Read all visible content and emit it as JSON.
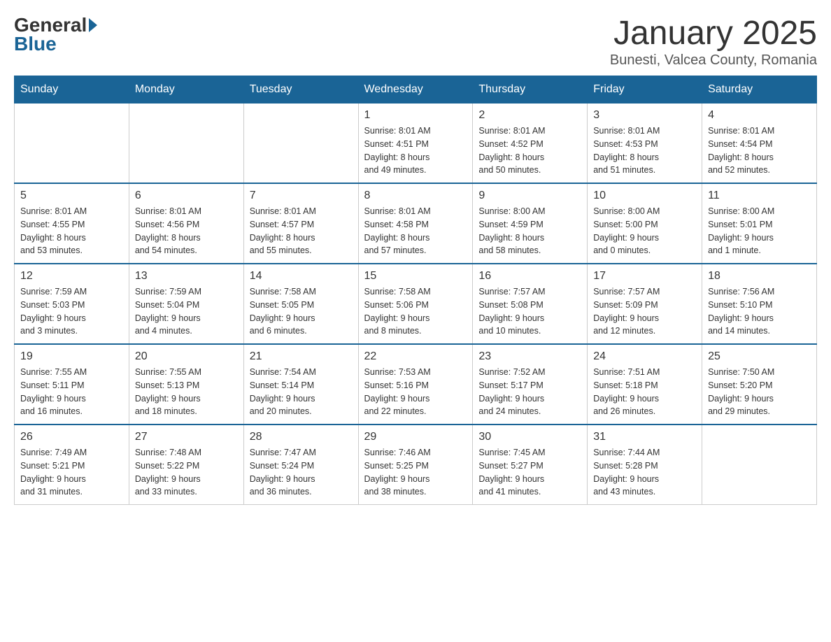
{
  "header": {
    "logo": {
      "general": "General",
      "blue": "Blue"
    },
    "title": "January 2025",
    "location": "Bunesti, Valcea County, Romania"
  },
  "days_of_week": [
    "Sunday",
    "Monday",
    "Tuesday",
    "Wednesday",
    "Thursday",
    "Friday",
    "Saturday"
  ],
  "weeks": [
    [
      {
        "day": "",
        "info": ""
      },
      {
        "day": "",
        "info": ""
      },
      {
        "day": "",
        "info": ""
      },
      {
        "day": "1",
        "info": "Sunrise: 8:01 AM\nSunset: 4:51 PM\nDaylight: 8 hours\nand 49 minutes."
      },
      {
        "day": "2",
        "info": "Sunrise: 8:01 AM\nSunset: 4:52 PM\nDaylight: 8 hours\nand 50 minutes."
      },
      {
        "day": "3",
        "info": "Sunrise: 8:01 AM\nSunset: 4:53 PM\nDaylight: 8 hours\nand 51 minutes."
      },
      {
        "day": "4",
        "info": "Sunrise: 8:01 AM\nSunset: 4:54 PM\nDaylight: 8 hours\nand 52 minutes."
      }
    ],
    [
      {
        "day": "5",
        "info": "Sunrise: 8:01 AM\nSunset: 4:55 PM\nDaylight: 8 hours\nand 53 minutes."
      },
      {
        "day": "6",
        "info": "Sunrise: 8:01 AM\nSunset: 4:56 PM\nDaylight: 8 hours\nand 54 minutes."
      },
      {
        "day": "7",
        "info": "Sunrise: 8:01 AM\nSunset: 4:57 PM\nDaylight: 8 hours\nand 55 minutes."
      },
      {
        "day": "8",
        "info": "Sunrise: 8:01 AM\nSunset: 4:58 PM\nDaylight: 8 hours\nand 57 minutes."
      },
      {
        "day": "9",
        "info": "Sunrise: 8:00 AM\nSunset: 4:59 PM\nDaylight: 8 hours\nand 58 minutes."
      },
      {
        "day": "10",
        "info": "Sunrise: 8:00 AM\nSunset: 5:00 PM\nDaylight: 9 hours\nand 0 minutes."
      },
      {
        "day": "11",
        "info": "Sunrise: 8:00 AM\nSunset: 5:01 PM\nDaylight: 9 hours\nand 1 minute."
      }
    ],
    [
      {
        "day": "12",
        "info": "Sunrise: 7:59 AM\nSunset: 5:03 PM\nDaylight: 9 hours\nand 3 minutes."
      },
      {
        "day": "13",
        "info": "Sunrise: 7:59 AM\nSunset: 5:04 PM\nDaylight: 9 hours\nand 4 minutes."
      },
      {
        "day": "14",
        "info": "Sunrise: 7:58 AM\nSunset: 5:05 PM\nDaylight: 9 hours\nand 6 minutes."
      },
      {
        "day": "15",
        "info": "Sunrise: 7:58 AM\nSunset: 5:06 PM\nDaylight: 9 hours\nand 8 minutes."
      },
      {
        "day": "16",
        "info": "Sunrise: 7:57 AM\nSunset: 5:08 PM\nDaylight: 9 hours\nand 10 minutes."
      },
      {
        "day": "17",
        "info": "Sunrise: 7:57 AM\nSunset: 5:09 PM\nDaylight: 9 hours\nand 12 minutes."
      },
      {
        "day": "18",
        "info": "Sunrise: 7:56 AM\nSunset: 5:10 PM\nDaylight: 9 hours\nand 14 minutes."
      }
    ],
    [
      {
        "day": "19",
        "info": "Sunrise: 7:55 AM\nSunset: 5:11 PM\nDaylight: 9 hours\nand 16 minutes."
      },
      {
        "day": "20",
        "info": "Sunrise: 7:55 AM\nSunset: 5:13 PM\nDaylight: 9 hours\nand 18 minutes."
      },
      {
        "day": "21",
        "info": "Sunrise: 7:54 AM\nSunset: 5:14 PM\nDaylight: 9 hours\nand 20 minutes."
      },
      {
        "day": "22",
        "info": "Sunrise: 7:53 AM\nSunset: 5:16 PM\nDaylight: 9 hours\nand 22 minutes."
      },
      {
        "day": "23",
        "info": "Sunrise: 7:52 AM\nSunset: 5:17 PM\nDaylight: 9 hours\nand 24 minutes."
      },
      {
        "day": "24",
        "info": "Sunrise: 7:51 AM\nSunset: 5:18 PM\nDaylight: 9 hours\nand 26 minutes."
      },
      {
        "day": "25",
        "info": "Sunrise: 7:50 AM\nSunset: 5:20 PM\nDaylight: 9 hours\nand 29 minutes."
      }
    ],
    [
      {
        "day": "26",
        "info": "Sunrise: 7:49 AM\nSunset: 5:21 PM\nDaylight: 9 hours\nand 31 minutes."
      },
      {
        "day": "27",
        "info": "Sunrise: 7:48 AM\nSunset: 5:22 PM\nDaylight: 9 hours\nand 33 minutes."
      },
      {
        "day": "28",
        "info": "Sunrise: 7:47 AM\nSunset: 5:24 PM\nDaylight: 9 hours\nand 36 minutes."
      },
      {
        "day": "29",
        "info": "Sunrise: 7:46 AM\nSunset: 5:25 PM\nDaylight: 9 hours\nand 38 minutes."
      },
      {
        "day": "30",
        "info": "Sunrise: 7:45 AM\nSunset: 5:27 PM\nDaylight: 9 hours\nand 41 minutes."
      },
      {
        "day": "31",
        "info": "Sunrise: 7:44 AM\nSunset: 5:28 PM\nDaylight: 9 hours\nand 43 minutes."
      },
      {
        "day": "",
        "info": ""
      }
    ]
  ]
}
